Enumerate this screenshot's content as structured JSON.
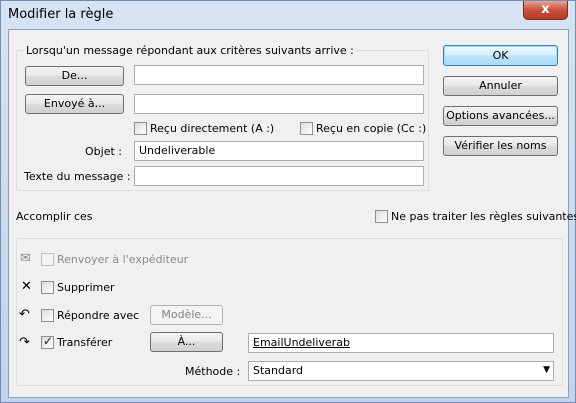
{
  "window": {
    "title": "Modifier la règle",
    "close_glyph": "x"
  },
  "criteria": {
    "heading": "Lorsqu'un message répondant aux critères suivants arrive :",
    "from_button": "De...",
    "sent_to_button": "Envoyé à...",
    "from_value": "",
    "sent_to_value": "",
    "received_directly": {
      "label": "Reçu directement (A :)",
      "checked": false
    },
    "received_cc": {
      "label": "Reçu en copie (Cc :)",
      "checked": false
    },
    "subject_label": "Objet :",
    "subject_value": "Undeliverable",
    "body_label": "Texte du message :",
    "body_value": ""
  },
  "side_buttons": {
    "ok": "OK",
    "cancel": "Annuler",
    "advanced": "Options avancées...",
    "check_names": "Vérifier les noms"
  },
  "actions": {
    "heading": "Accomplir ces",
    "stop_rules": {
      "label": "Ne pas traiter les règles suivantes",
      "checked": false
    },
    "redirect": {
      "label": "Renvoyer à l'expéditeur",
      "checked": false,
      "enabled": false,
      "icon": "redirect-icon"
    },
    "delete": {
      "label": "Supprimer",
      "checked": false,
      "icon": "delete-icon"
    },
    "reply": {
      "label": "Répondre avec",
      "checked": false,
      "icon": "reply-icon",
      "template_button": "Modèle..."
    },
    "forward": {
      "label": "Transférer",
      "checked": true,
      "icon": "forward-icon",
      "to_button": "À...",
      "recipient": "EmailUndeliverab"
    },
    "method_label": "Méthode :",
    "method_value": "Standard"
  }
}
